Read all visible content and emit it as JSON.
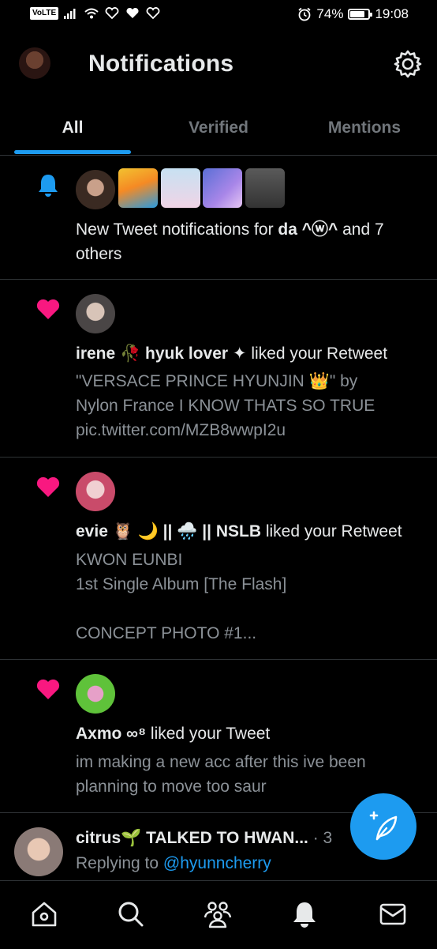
{
  "status_bar": {
    "network": "VoLTE",
    "battery_percent": "74%",
    "battery_level": 0.74,
    "time": "19:08"
  },
  "header": {
    "title": "Notifications"
  },
  "tabs": [
    {
      "label": "All",
      "active": true
    },
    {
      "label": "Verified",
      "active": false
    },
    {
      "label": "Mentions",
      "active": false
    }
  ],
  "notifications": [
    {
      "type": "bell",
      "text_prefix": "New Tweet notifications for ",
      "name": "da ^ⓦ^",
      "text_suffix": " and 7",
      "line2": "others"
    },
    {
      "type": "like",
      "actor": "irene 🥀 hyuk lover ✦",
      "action": " liked your Retweet",
      "body": [
        "\"VERSACE PRINCE HYUNJIN 👑\" by",
        "Nylon France I KNOW THATS SO TRUE",
        "pic.twitter.com/MZB8wwpI2u"
      ]
    },
    {
      "type": "like",
      "actor": "evie 🦉 🌙 || 🌧️ || NSLB",
      "action": " liked your Retweet",
      "body": [
        "KWON EUNBI",
        "1st Single Album [The Flash]",
        "",
        "CONCEPT PHOTO #1..."
      ]
    },
    {
      "type": "like",
      "actor": "Axmo ∞⁸",
      "action": " liked your Tweet",
      "body": [
        "im making a new acc after this ive been",
        "planning to move too saur"
      ]
    },
    {
      "type": "reply",
      "author": "citrus🌱 TALKED TO HWAN...",
      "meta": " · 3",
      "replying_prefix": "Replying to ",
      "replying_handle": "@hyunncherry"
    }
  ],
  "colors": {
    "accent": "#1d9bf0",
    "like": "#f91880",
    "muted": "#71767b"
  }
}
